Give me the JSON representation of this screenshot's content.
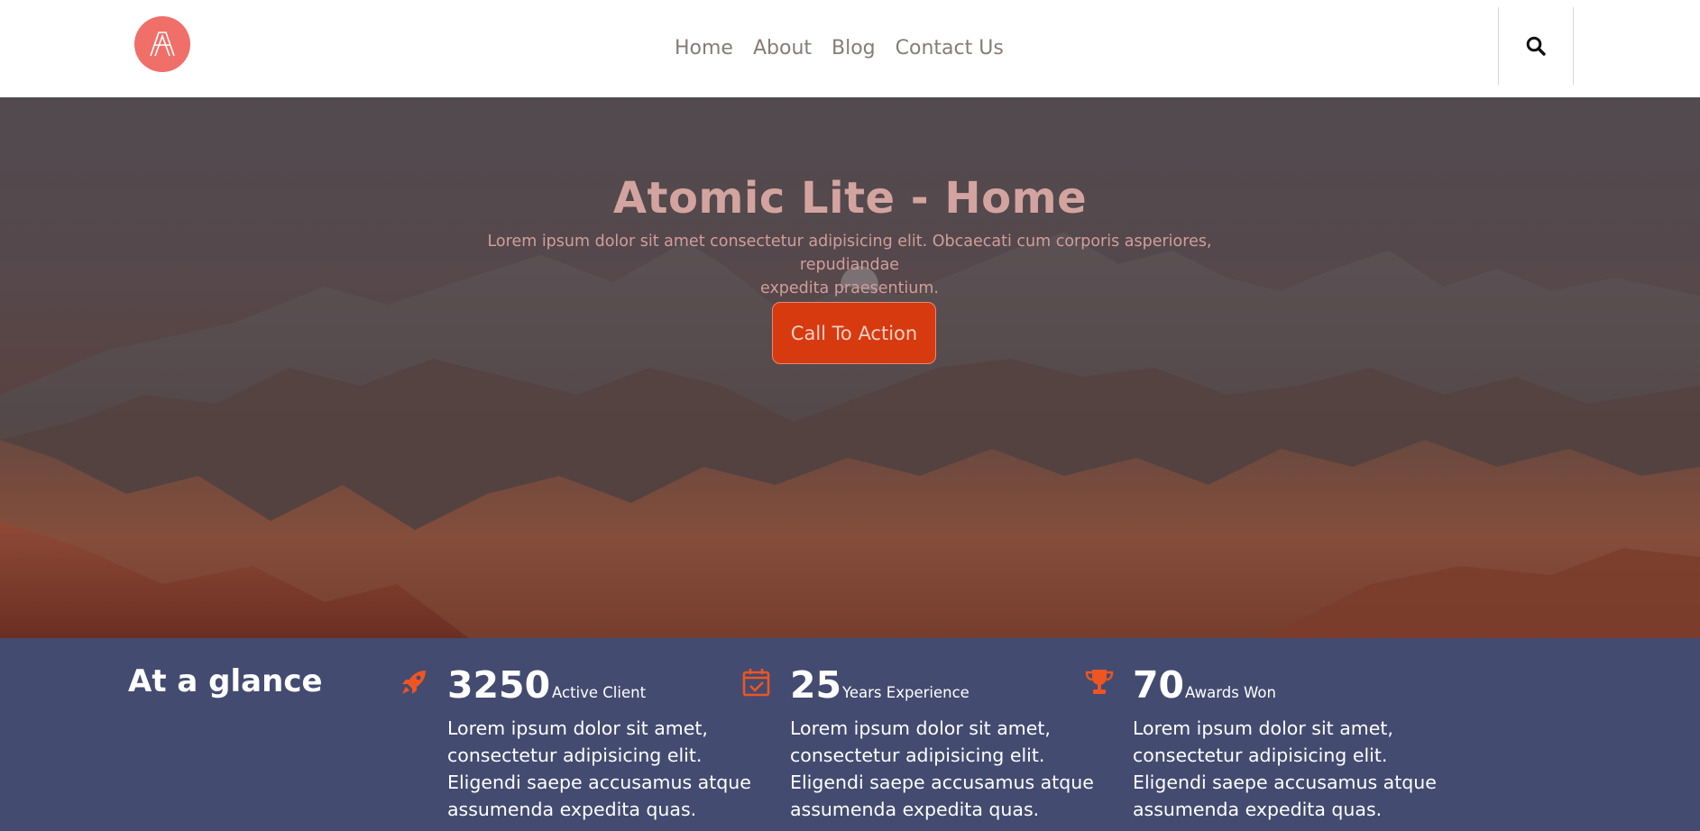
{
  "header": {
    "nav": [
      "Home",
      "About",
      "Blog",
      "Contact Us"
    ],
    "logo_icon": "atomic-logo-icon",
    "search_icon": "search-icon",
    "logo_color": "#f06f69"
  },
  "hero": {
    "title": "Atomic Lite - Home",
    "subtitle_line1": "Lorem ipsum dolor sit amet consectetur adipisicing elit. Obcaecati cum corporis asperiores, repudiandae",
    "subtitle_line2": "expedita praesentium.",
    "cta_label": "Call To Action",
    "cta_color": "#d73a0e"
  },
  "stats": {
    "heading": "At a glance",
    "background": "#434b70",
    "accent": "#ee5522",
    "items": [
      {
        "icon": "rocket-icon",
        "number": "3250",
        "label": "Active Client",
        "description": "Lorem ipsum dolor sit amet, consectetur adipisicing elit. Eligendi saepe accusamus atque assumenda expedita quas."
      },
      {
        "icon": "calendar-check-icon",
        "number": "25",
        "label": "Years Experience",
        "description": "Lorem ipsum dolor sit amet, consectetur adipisicing elit. Eligendi saepe accusamus atque assumenda expedita quas."
      },
      {
        "icon": "trophy-icon",
        "number": "70",
        "label": "Awards Won",
        "description": "Lorem ipsum dolor sit amet, consectetur adipisicing elit. Eligendi saepe accusamus atque assumenda expedita quas."
      }
    ]
  }
}
